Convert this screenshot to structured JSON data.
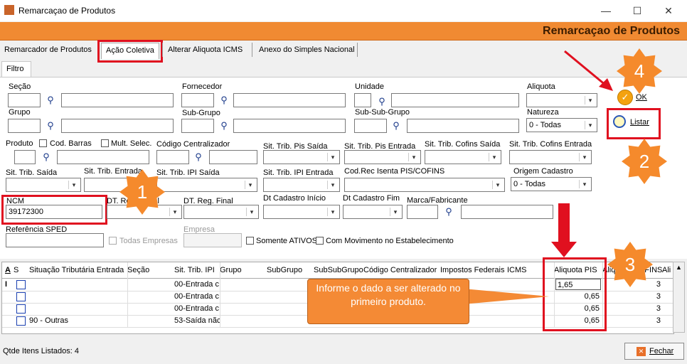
{
  "window": {
    "title": "Remarcaçao de Produtos",
    "minimize": "—",
    "maximize": "☐",
    "close": "✕"
  },
  "header": {
    "title": "Remarcaçao de Produtos"
  },
  "tabs": [
    "Remarcador de Produtos",
    "Ação Coletiva",
    "Alterar Aliquota ICMS",
    "Anexo do Simples Nacional"
  ],
  "subtab": "Filtro",
  "filters": {
    "secao": "Seção",
    "grupo": "Grupo",
    "fornecedor": "Fornecedor",
    "subgrupo": "Sub-Grupo",
    "unidade": "Unidade",
    "subsubgrupo": "Sub-Sub-Grupo",
    "aliquota": "Aliquota",
    "natureza": "Natureza",
    "natureza_value": "0 - Todas",
    "produto": "Produto",
    "cod_barras": "Cod. Barras",
    "mult_selec": "Mult. Selec.",
    "codigo_centralizador": "Código Centralizador",
    "sit_trib_pis_saida": "Sit. Trib. Pis Saída",
    "sit_trib_pis_entrada": "Sit. Trib. Pis Entrada",
    "sit_trib_cofins_saida": "Sit. Trib. Cofins Saída",
    "sit_trib_cofins_entrada": "Sit. Trib. Cofins Entrada",
    "sit_trib_saida": "Sit. Trib. Saída",
    "sit_trib_entrada": "Sit. Trib. Entrada",
    "sit_trib_ipi_saida": "Sit. Trib. IPI Saída",
    "sit_trib_ipi_entrada": "Sit. Trib. IPI Entrada",
    "cod_rec_isenta": "Cod.Rec Isenta PIS/COFINS",
    "origem_cadastro": "Origem Cadastro",
    "origem_value": "0 - Todas",
    "ncm": "NCM",
    "ncm_value": "39172300",
    "dt_reg_inicial": "DT. Reg. Inicial",
    "dt_reg_final": "DT. Reg. Final",
    "dt_cadastro_inicio": "Dt Cadastro Início",
    "dt_cadastro_fim": "Dt Cadastro  Fim",
    "marca_fabricante": "Marca/Fabricante",
    "referencia_sped": "Referência SPED",
    "todas_empresas": "Todas Empresas",
    "empresa": "Empresa",
    "somente_ativos": "Somente ATIVOS",
    "com_movimento": "Com Movimento no Estabelecimento"
  },
  "buttons": {
    "ok": "OK",
    "listar": "Listar",
    "fechar": "Fechar"
  },
  "grid": {
    "headers": [
      "A",
      "S",
      "Situação Tributária Entrada",
      "Seção",
      "Sit. Trib. IPI",
      "Grupo",
      "SubGrupo",
      "SubSubGrupo",
      "Código Centralizador",
      "Impostos Federais",
      "ICMS",
      "Aliquota PIS",
      "Aliquota COFINS",
      "Ali"
    ],
    "rows": [
      {
        "sit_entrada": "",
        "sit_ipi": "00-Entrada c",
        "aliq_pis": "1,65",
        "cofins": "3"
      },
      {
        "sit_entrada": "",
        "sit_ipi": "00-Entrada c",
        "aliq_pis": "0,65",
        "cofins": "3"
      },
      {
        "sit_entrada": "",
        "sit_ipi": "00-Entrada c",
        "aliq_pis": "0,65",
        "cofins": "3"
      },
      {
        "sit_entrada": "90 - Outras",
        "sit_ipi": "53-Saída nãc",
        "aliq_pis": "0,65",
        "cofins": "3"
      }
    ]
  },
  "footer": {
    "qtde": "Qtde Itens Listados: 4"
  },
  "annotations": {
    "s1": "1",
    "s2": "2",
    "s3": "3",
    "s4": "4",
    "callout": "Informe o dado a ser alterado no primeiro produto."
  },
  "colors": {
    "accent": "#f08a32",
    "highlight": "#e0101f"
  }
}
